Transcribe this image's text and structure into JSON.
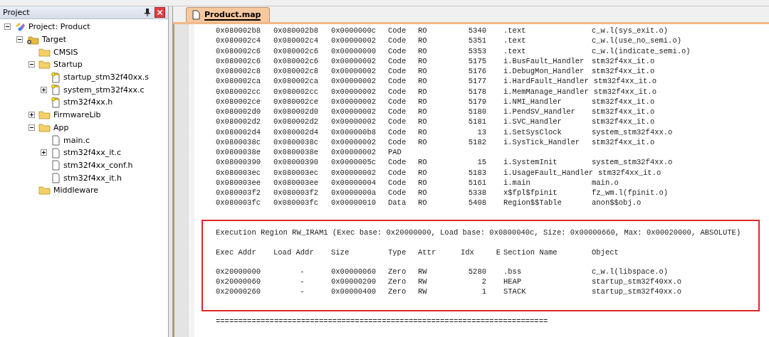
{
  "panel": {
    "title": "Project"
  },
  "tree": [
    {
      "label": "Project: Product",
      "kind": "project",
      "expanded": true,
      "children": [
        {
          "label": "Target",
          "kind": "target",
          "expanded": true,
          "children": [
            {
              "label": "CMSIS",
              "kind": "folder"
            },
            {
              "label": "Startup",
              "kind": "folder",
              "expanded": true,
              "children": [
                {
                  "label": "startup_stm32f40xx.s",
                  "kind": "file",
                  "readonly": true
                },
                {
                  "label": "system_stm32f4xx.c",
                  "kind": "file",
                  "readonly": true,
                  "expanded": false
                },
                {
                  "label": "stm32f4xx.h",
                  "kind": "file",
                  "readonly": true
                }
              ]
            },
            {
              "label": "FirmwareLib",
              "kind": "folder",
              "expanded": false
            },
            {
              "label": "App",
              "kind": "folder",
              "expanded": true,
              "children": [
                {
                  "label": "main.c",
                  "kind": "file",
                  "readonly": false
                },
                {
                  "label": "stm32f4xx_it.c",
                  "kind": "file",
                  "readonly": false,
                  "expanded": false
                },
                {
                  "label": "stm32f4xx_conf.h",
                  "kind": "file",
                  "readonly": false
                },
                {
                  "label": "stm32f4xx_it.h",
                  "kind": "file",
                  "readonly": false
                }
              ]
            },
            {
              "label": "Middleware",
              "kind": "folder"
            }
          ]
        }
      ]
    }
  ],
  "tab": {
    "label": "Product.map",
    "selected": true
  },
  "map_rows": [
    {
      "exec": "0x080002b8",
      "load": "0x080002b8",
      "size": "0x0000000c",
      "type": "Code",
      "attr": "RO",
      "idx": "5340",
      "section": ".text",
      "object": "c_w.l(sys_exit.o)"
    },
    {
      "exec": "0x080002c4",
      "load": "0x080002c4",
      "size": "0x00000002",
      "type": "Code",
      "attr": "RO",
      "idx": "5351",
      "section": ".text",
      "object": "c_w.l(use_no_semi.o)"
    },
    {
      "exec": "0x080002c6",
      "load": "0x080002c6",
      "size": "0x00000000",
      "type": "Code",
      "attr": "RO",
      "idx": "5353",
      "section": ".text",
      "object": "c_w.l(indicate_semi.o)"
    },
    {
      "exec": "0x080002c6",
      "load": "0x080002c6",
      "size": "0x00000002",
      "type": "Code",
      "attr": "RO",
      "idx": "5175",
      "section": "i.BusFault_Handler",
      "object": "stm32f4xx_it.o"
    },
    {
      "exec": "0x080002c8",
      "load": "0x080002c8",
      "size": "0x00000002",
      "type": "Code",
      "attr": "RO",
      "idx": "5176",
      "section": "i.DebugMon_Handler",
      "object": "stm32f4xx_it.o"
    },
    {
      "exec": "0x080002ca",
      "load": "0x080002ca",
      "size": "0x00000002",
      "type": "Code",
      "attr": "RO",
      "idx": "5177",
      "section": "i.HardFault_Handler",
      "object": "stm32f4xx_it.o"
    },
    {
      "exec": "0x080002cc",
      "load": "0x080002cc",
      "size": "0x00000002",
      "type": "Code",
      "attr": "RO",
      "idx": "5178",
      "section": "i.MemManage_Handler",
      "object": "stm32f4xx_it.o"
    },
    {
      "exec": "0x080002ce",
      "load": "0x080002ce",
      "size": "0x00000002",
      "type": "Code",
      "attr": "RO",
      "idx": "5179",
      "section": "i.NMI_Handler",
      "object": "stm32f4xx_it.o"
    },
    {
      "exec": "0x080002d0",
      "load": "0x080002d0",
      "size": "0x00000002",
      "type": "Code",
      "attr": "RO",
      "idx": "5180",
      "section": "i.PendSV_Handler",
      "object": "stm32f4xx_it.o"
    },
    {
      "exec": "0x080002d2",
      "load": "0x080002d2",
      "size": "0x00000002",
      "type": "Code",
      "attr": "RO",
      "idx": "5181",
      "section": "i.SVC_Handler",
      "object": "stm32f4xx_it.o"
    },
    {
      "exec": "0x080002d4",
      "load": "0x080002d4",
      "size": "0x000000b8",
      "type": "Code",
      "attr": "RO",
      "idx": "13",
      "section": "i.SetSysClock",
      "object": "system_stm32f4xx.o"
    },
    {
      "exec": "0x0800038c",
      "load": "0x0800038c",
      "size": "0x00000002",
      "type": "Code",
      "attr": "RO",
      "idx": "5182",
      "section": "i.SysTick_Handler",
      "object": "stm32f4xx_it.o"
    },
    {
      "exec": "0x0800038e",
      "load": "0x0800038e",
      "size": "0x00000002",
      "type": "PAD"
    },
    {
      "exec": "0x08000390",
      "load": "0x08000390",
      "size": "0x0000005c",
      "type": "Code",
      "attr": "RO",
      "idx": "15",
      "section": "i.SystemInit",
      "object": "system_stm32f4xx.o"
    },
    {
      "exec": "0x080003ec",
      "load": "0x080003ec",
      "size": "0x00000002",
      "type": "Code",
      "attr": "RO",
      "idx": "5183",
      "section": "i.UsageFault_Handler",
      "object": "stm32f4xx_it.o"
    },
    {
      "exec": "0x080003ee",
      "load": "0x080003ee",
      "size": "0x00000004",
      "type": "Code",
      "attr": "RO",
      "idx": "5161",
      "section": "i.main",
      "object": "main.o"
    },
    {
      "exec": "0x080003f2",
      "load": "0x080003f2",
      "size": "0x0000000a",
      "type": "Code",
      "attr": "RO",
      "idx": "5338",
      "section": "x$fpl$fpinit",
      "object": "fz_wm.l(fpinit.o)"
    },
    {
      "exec": "0x080003fc",
      "load": "0x080003fc",
      "size": "0x00000010",
      "type": "Data",
      "attr": "RO",
      "idx": "5408",
      "section": "Region$$Table",
      "object": "anon$$obj.o"
    }
  ],
  "region": {
    "title": "Execution Region RW_IRAM1 (Exec base: 0x20000000, Load base: 0x0800040c, Size: 0x00000660, Max: 0x00020000, ABSOLUTE)",
    "columns": [
      "Exec Addr",
      "Load Addr",
      "Size",
      "Type",
      "Attr",
      "Idx",
      "E",
      "Section Name",
      "Object"
    ],
    "rows": [
      {
        "exec": "0x20000000",
        "load": "-",
        "size": "0x00000060",
        "type": "Zero",
        "attr": "RW",
        "idx": "5280",
        "section": ".bss",
        "object": "c_w.l(libspace.o)"
      },
      {
        "exec": "0x20000060",
        "load": "-",
        "size": "0x00000200",
        "type": "Zero",
        "attr": "RW",
        "idx": "2",
        "section": "HEAP",
        "object": "startup_stm32f40xx.o"
      },
      {
        "exec": "0x20000260",
        "load": "-",
        "size": "0x00000400",
        "type": "Zero",
        "attr": "RW",
        "idx": "1",
        "section": "STACK",
        "object": "startup_stm32f40xx.o"
      }
    ]
  },
  "separator": "=========================================================================="
}
